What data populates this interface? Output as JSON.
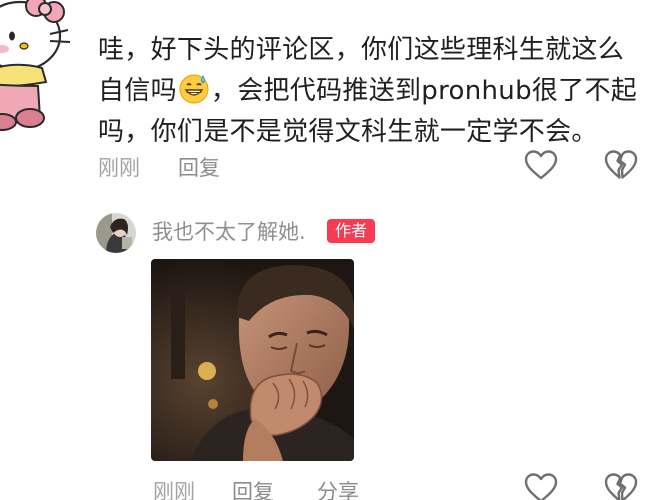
{
  "comment": {
    "text_part1": "哇，好下头的评论区，你们这些理科生就这么自信吗",
    "text_part2": "，会把代码推送到pronhub很了不起吗，你们是不是觉得文科生就一定学不会。",
    "emoji_icon": "grinning-face-with-sweat-icon",
    "time": "刚刚",
    "reply_label": "回复"
  },
  "author_reply": {
    "name": "我也不太了解她.",
    "badge": "作者",
    "time": "刚刚",
    "reply_label": "回复",
    "share_label": "分享"
  },
  "colors": {
    "badge_bg": "#f63b55",
    "meta_text": "#8c8c8c",
    "body_text": "#1f1f1f"
  },
  "icons": [
    "heart-outline-icon",
    "broken-heart-icon",
    "hello-kitty-avatar",
    "user-avatar"
  ]
}
